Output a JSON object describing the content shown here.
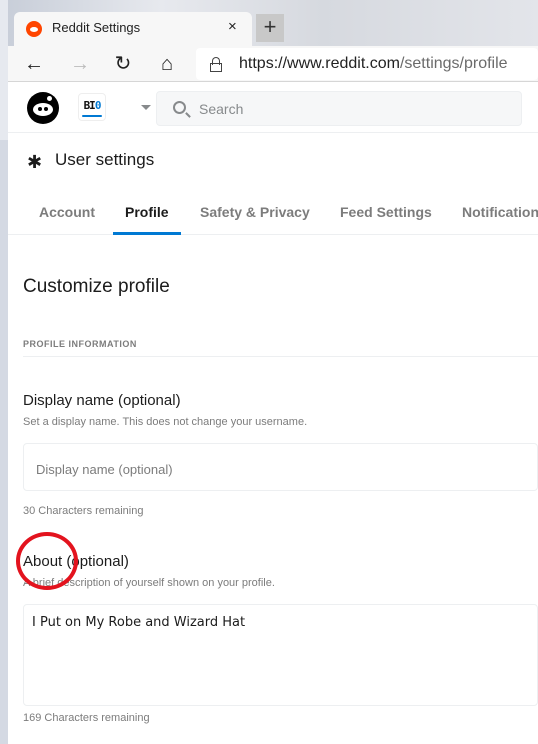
{
  "browser": {
    "tab_title": "Reddit Settings",
    "tab_close": "×",
    "new_tab": "+",
    "nav": {
      "back": "←",
      "forward": "→",
      "reload": "↻",
      "home": "⌂"
    },
    "url_host": "https://www.reddit.com",
    "url_path": "/settings/profile"
  },
  "header": {
    "community_icon_text_a": "BI",
    "community_icon_text_b": "0",
    "search_placeholder": "Search"
  },
  "settings": {
    "gear": "✱",
    "title": "User settings",
    "tabs": [
      {
        "label": "Account",
        "active": false
      },
      {
        "label": "Profile",
        "active": true
      },
      {
        "label": "Safety & Privacy",
        "active": false
      },
      {
        "label": "Feed Settings",
        "active": false
      },
      {
        "label": "Notifications",
        "active": false
      }
    ],
    "accent_color": "#0079d3"
  },
  "profile": {
    "heading": "Customize profile",
    "section_label": "PROFILE INFORMATION",
    "display_name": {
      "title": "Display name (optional)",
      "description": "Set a display name. This does not change your username.",
      "placeholder": "Display name (optional)",
      "value": "",
      "remaining": "30 Characters remaining"
    },
    "about": {
      "title": "About (optional)",
      "description": "A brief description of yourself shown on your profile.",
      "value": "I Put on My Robe and Wizard Hat",
      "remaining": "169 Characters remaining"
    }
  },
  "annotation": {
    "color": "#e3131e",
    "target": "About label"
  }
}
